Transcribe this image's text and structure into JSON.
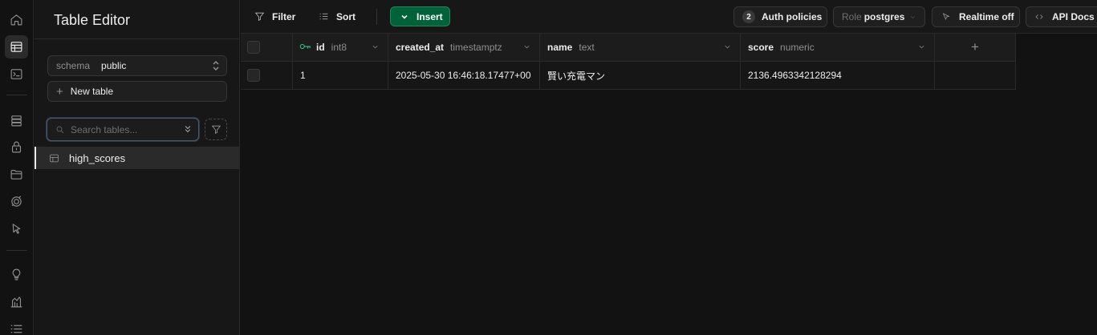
{
  "rail": {
    "icons": [
      "home-icon",
      "table-editor-icon",
      "sql-editor-icon",
      "database-icon",
      "auth-icon",
      "storage-icon",
      "realtime-icon",
      "functions-icon",
      "advisors-icon",
      "reports-icon",
      "logs-icon"
    ]
  },
  "sidebar": {
    "title": "Table Editor",
    "schema_label": "schema",
    "schema_value": "public",
    "new_table_label": "New table",
    "search_placeholder": "Search tables...",
    "tables": [
      {
        "name": "high_scores",
        "selected": true
      }
    ]
  },
  "toolbar": {
    "filter_label": "Filter",
    "sort_label": "Sort",
    "insert_label": "Insert",
    "auth_policies_count": "2",
    "auth_policies_label": "Auth policies",
    "role_label": "Role",
    "role_value": "postgres",
    "realtime_label": "Realtime off",
    "api_docs_label": "API Docs"
  },
  "grid": {
    "columns": [
      {
        "name": "id",
        "type": "int8",
        "primary_key": true
      },
      {
        "name": "created_at",
        "type": "timestamptz"
      },
      {
        "name": "name",
        "type": "text"
      },
      {
        "name": "score",
        "type": "numeric"
      }
    ],
    "add_column_symbol": "+",
    "rows": [
      {
        "id": "1",
        "created_at": "2025-05-30 16:46:18.17477+00",
        "name": "賢い充電マン",
        "score": "2136.4963342128294"
      }
    ]
  },
  "colors": {
    "background": "#121212",
    "panel": "#171717",
    "accent_green": "#3ecf8e",
    "insert_button": "#006239"
  }
}
